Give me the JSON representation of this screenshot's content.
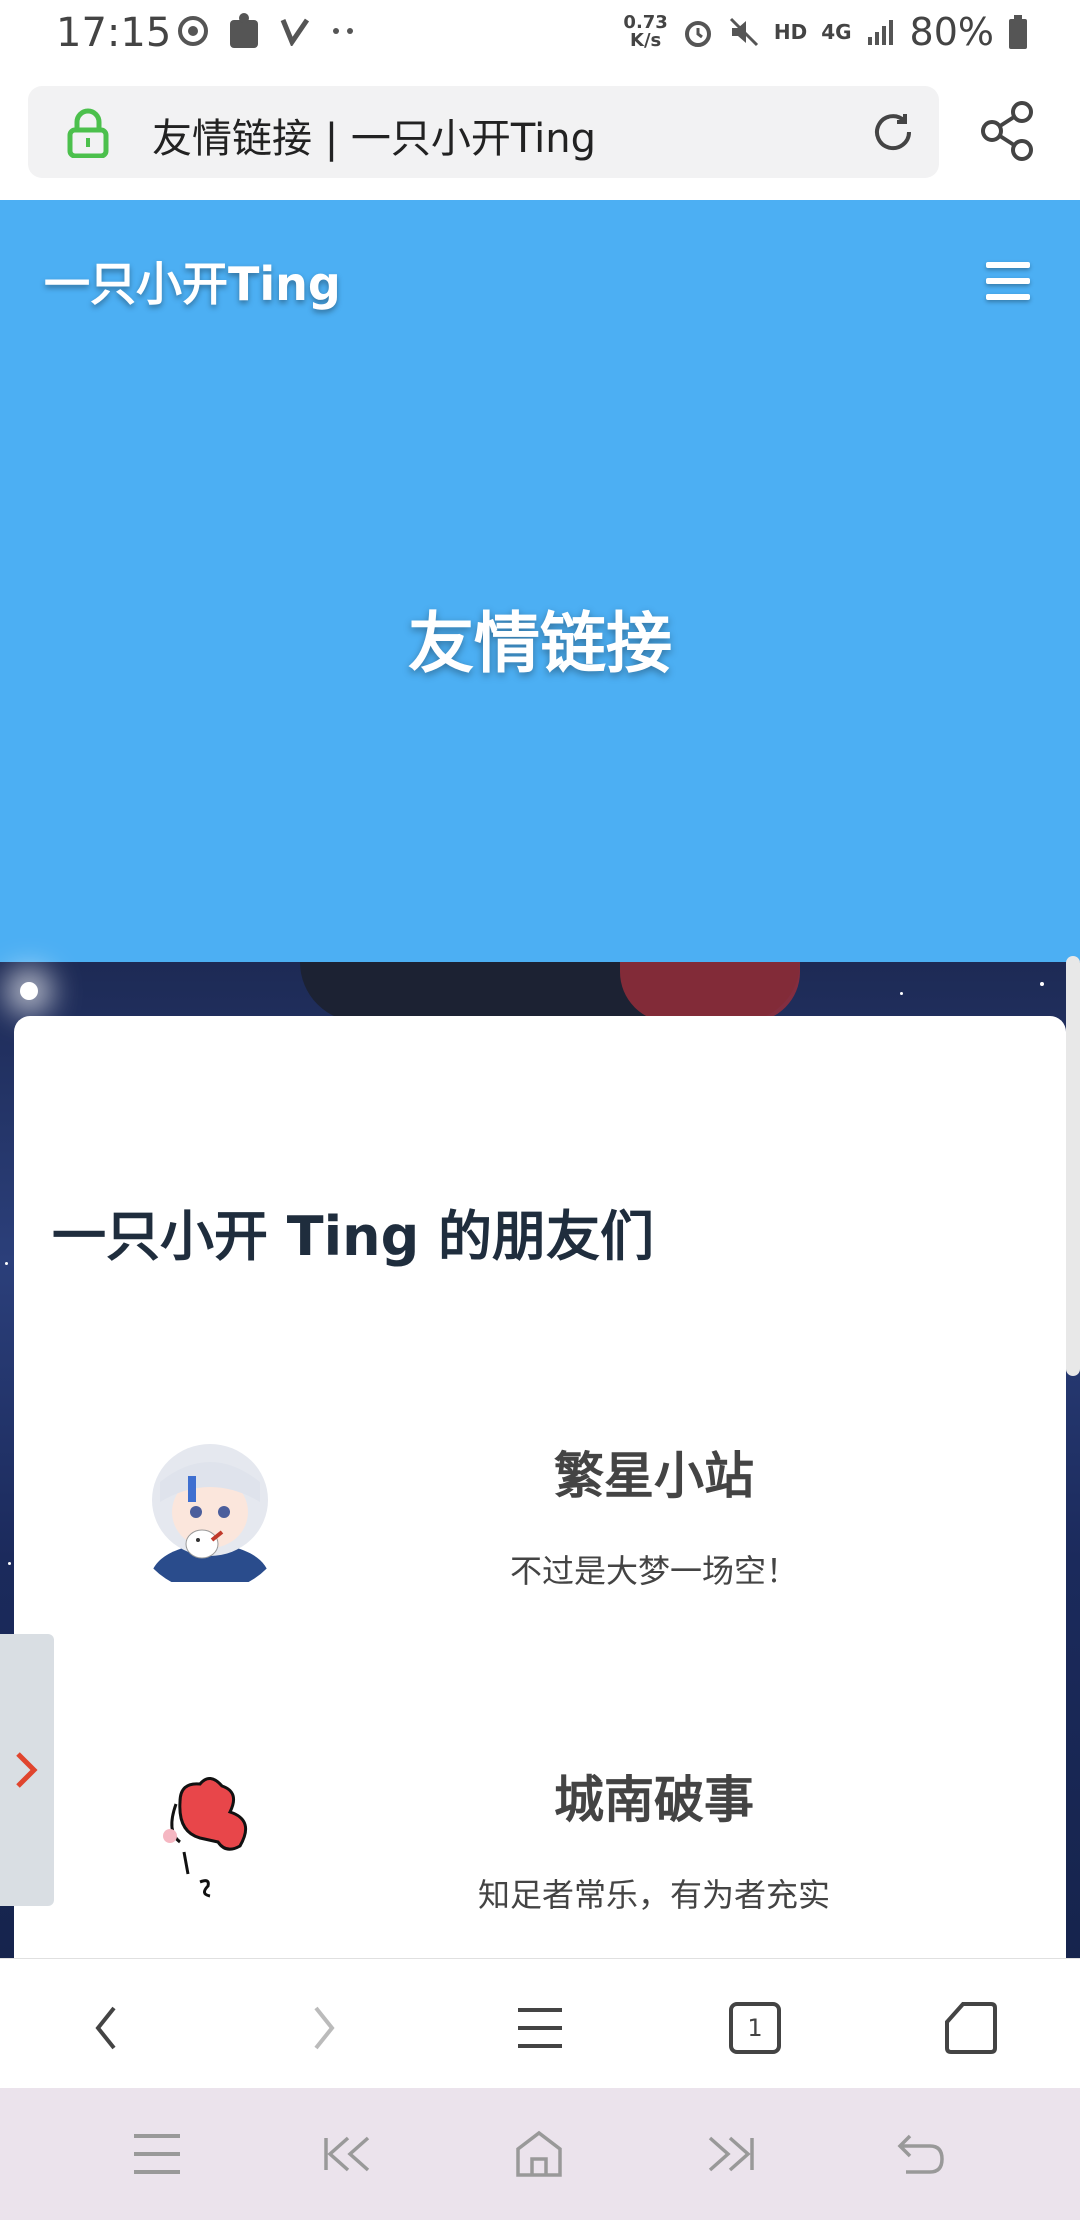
{
  "status": {
    "time": "17:15",
    "speed_value": "0.73",
    "speed_unit": "K/s",
    "hd": "HD",
    "network": "4G",
    "battery": "80%"
  },
  "address_bar": {
    "url_text": "友情链接 | 一只小开Ting"
  },
  "header": {
    "site_title": "一只小开Ting",
    "hero_title": "友情链接"
  },
  "content": {
    "heading": "一只小开 Ting 的朋友们",
    "links": [
      {
        "name": "繁星小站",
        "desc": "不过是大梦一场空！"
      },
      {
        "name": "城南破事",
        "desc": "知足者常乐，有为者充实"
      }
    ]
  },
  "browser_nav": {
    "tab_count": "1"
  },
  "icons": {
    "lock": "lock-icon",
    "reload": "reload-icon",
    "share": "share-icon",
    "menu": "hamburger-menu-icon"
  },
  "colors": {
    "hero_blue": "#4caff3",
    "lock_green": "#4cc04c",
    "side_arrow": "#e0452e"
  }
}
